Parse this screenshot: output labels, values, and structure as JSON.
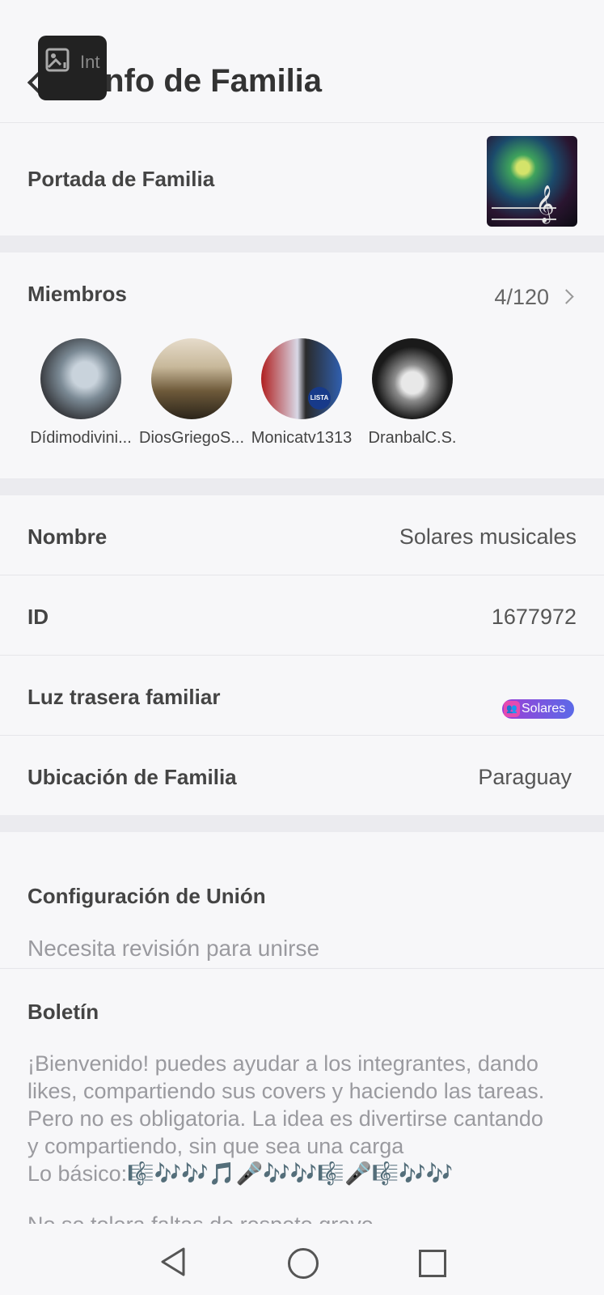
{
  "header": {
    "title": "Info de Familia",
    "overlay_text": "Int"
  },
  "cover": {
    "label": "Portada de Familia"
  },
  "members": {
    "label": "Miembros",
    "count": "4/120",
    "list": [
      {
        "name": "Dídimodivini..."
      },
      {
        "name": "DiosGriegoS..."
      },
      {
        "name": "Monicatv1313"
      },
      {
        "name": "DranbalC.S."
      }
    ],
    "badge_text": "LISTA B"
  },
  "info": {
    "nombre_label": "Nombre",
    "nombre_value": "Solares musicales",
    "id_label": "ID",
    "id_value": "1677972",
    "luz_label": "Luz trasera familiar",
    "luz_chip": "Solares",
    "ubicacion_label": "Ubicación de Familia",
    "ubicacion_value": "Paraguay"
  },
  "union": {
    "label": "Configuración de Unión",
    "value": "Necesita revisión para unirse"
  },
  "boletin": {
    "label": "Boletín",
    "lines": [
      "¡Bienvenido! puedes ayudar a los integrantes, dando",
      "likes, compartiendo sus covers y haciendo las tareas.",
      "Pero no es obligatoria. La idea es divertirse cantando",
      "y compartiendo, sin que sea una carga",
      "Lo básico:🎼🎶🎶🎵🎤🎶🎶🎼🎤🎼🎶🎶"
    ],
    "cut_line": "No se tolera faltas de respeto grave"
  },
  "colors": {
    "background": "#f7f7f9",
    "divider": "#ebebef",
    "chip_gradient_start": "#9b3fd6",
    "chip_gradient_end": "#5c6ae8"
  }
}
